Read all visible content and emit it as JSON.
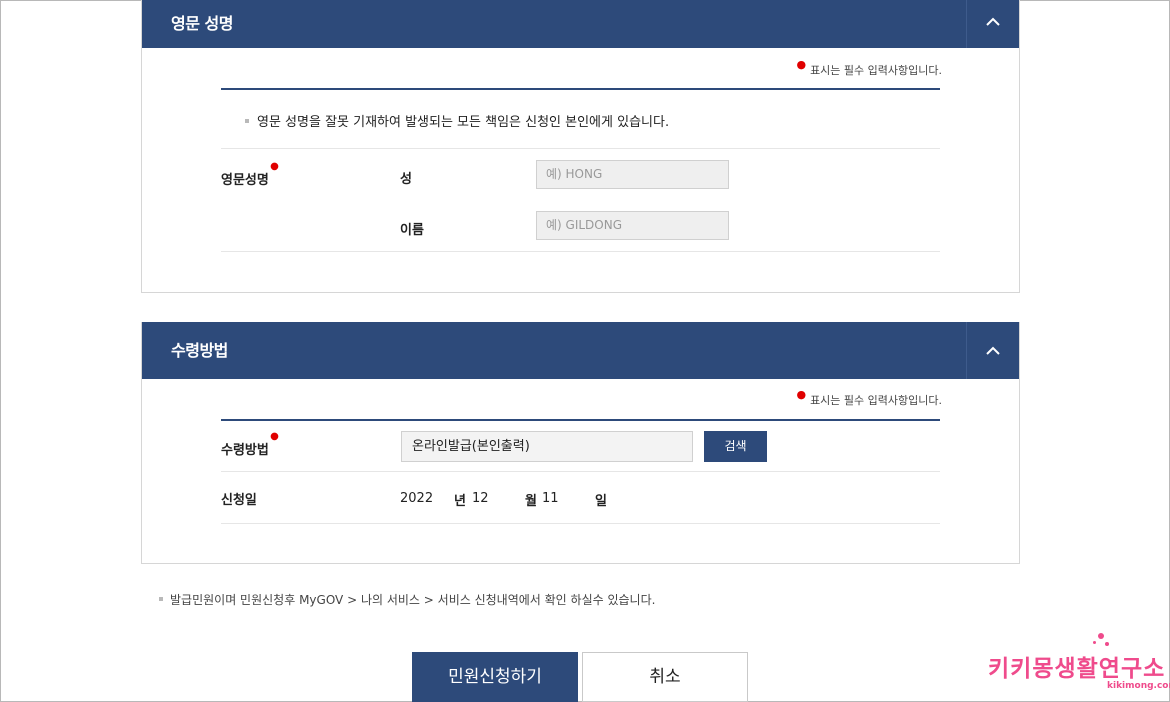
{
  "required_note": "표시는 필수 입력사항입니다.",
  "section_english": {
    "title": "영문 성명",
    "notice": "영문 성명을 잘못 기재하여 발생되는 모든 책임은 신청인 본인에게 있습니다.",
    "field_label": "영문성명",
    "surname_label": "성",
    "surname_placeholder": "예) HONG",
    "given_label": "이름",
    "given_placeholder": "예) GILDONG"
  },
  "section_receipt": {
    "title": "수령방법",
    "method_label": "수령방법",
    "method_value": "온라인발급(본인출력)",
    "search_label": "검색",
    "date_label": "신청일",
    "year": "2022",
    "year_unit": "년",
    "month": "12",
    "month_unit": "월",
    "day": "11",
    "day_unit": "일"
  },
  "footer_note": "발급민원이며 민원신청후 MyGOV > 나의 서비스 > 서비스 신청내역에서 확인 하실수 있습니다.",
  "actions": {
    "submit": "민원신청하기",
    "cancel": "취소"
  },
  "watermark": {
    "text": "키키몽생활연구소",
    "sub": "kikimong.com"
  },
  "colors": {
    "header_bg": "#2d4a7a",
    "required_dot": "#e00000",
    "watermark": "#ef4b8c"
  },
  "icons": {
    "collapse": "chevron-up-icon",
    "bullet": "square-bullet-icon"
  }
}
